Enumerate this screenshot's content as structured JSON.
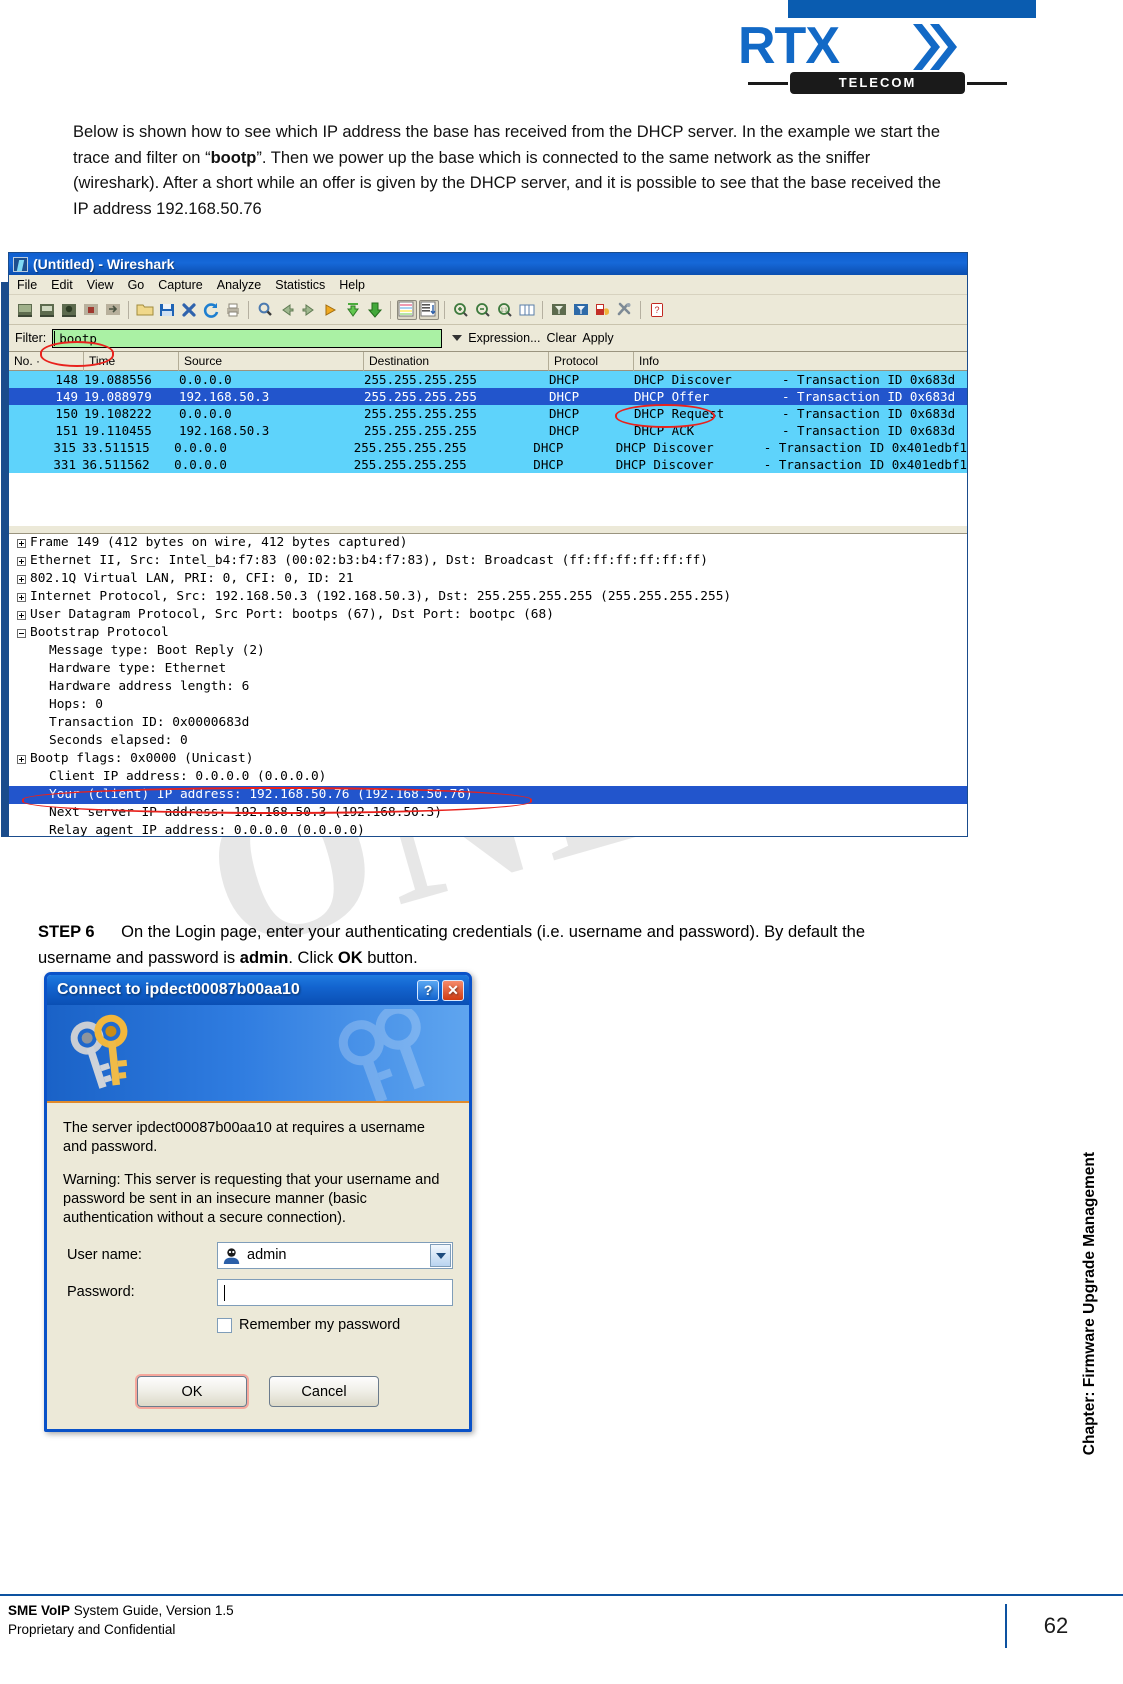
{
  "brand": {
    "name": "RTX",
    "sub": "TELECOM"
  },
  "intro_paragraph": "Below is shown how to see which IP address the base has received from the DHCP server. In the example we start the trace and filter on “bootp”. Then we power up the base which is connected to the same network as the sniffer (wireshark). After a short while an offer is given by the DHCP server, and it is possible to see that the base received the IP address 192.168.50.76",
  "intro_parts": {
    "p1": "Below is shown how to see which IP address the base has received from the DHCP server. In the example we start the trace and filter on “",
    "bold1": "bootp",
    "p2": "”. Then we power up the base which is connected to the same network as the sniffer (wireshark). After a short while an offer is given by the DHCP server, and it is possible to see that the base received the IP address 192.168.50.76"
  },
  "watermark": "ONLY",
  "step": {
    "label": "STEP 6",
    "text1": "On the Login page, enter your authenticating credentials (i.e. username and password). By default the username and password is ",
    "bold_admin": "admin",
    "text2": ". Click ",
    "bold_ok": "OK",
    "text3": " button."
  },
  "wireshark": {
    "title": "(Untitled) - Wireshark",
    "menu": [
      "File",
      "Edit",
      "View",
      "Go",
      "Capture",
      "Analyze",
      "Statistics",
      "Help"
    ],
    "filter": {
      "label": "Filter:",
      "value": "bootp",
      "placeholder": "",
      "expression_button": "Expression...",
      "clear_button": "Clear",
      "apply_button": "Apply"
    },
    "columns": [
      "No. ·",
      "Time",
      "Source",
      "Destination",
      "Protocol",
      "Info"
    ],
    "packets": [
      {
        "no": "148",
        "time": "19.088556",
        "src": "0.0.0.0",
        "dst": "255.255.255.255",
        "proto": "DHCP",
        "info_name": "DHCP Discover",
        "info_rest": "- Transaction ID 0x683d",
        "selected": false
      },
      {
        "no": "149",
        "time": "19.088979",
        "src": "192.168.50.3",
        "dst": "255.255.255.255",
        "proto": "DHCP",
        "info_name": "DHCP Offer",
        "info_rest": "- Transaction ID 0x683d",
        "selected": true
      },
      {
        "no": "150",
        "time": "19.108222",
        "src": "0.0.0.0",
        "dst": "255.255.255.255",
        "proto": "DHCP",
        "info_name": "DHCP Request",
        "info_rest": "- Transaction ID 0x683d",
        "selected": false
      },
      {
        "no": "151",
        "time": "19.110455",
        "src": "192.168.50.3",
        "dst": "255.255.255.255",
        "proto": "DHCP",
        "info_name": "DHCP ACK",
        "info_rest": "- Transaction ID 0x683d",
        "selected": false
      },
      {
        "no": "315",
        "time": "33.511515",
        "src": "0.0.0.0",
        "dst": "255.255.255.255",
        "proto": "DHCP",
        "info_name": "DHCP Discover",
        "info_rest": "- Transaction ID 0x401edbf1",
        "selected": false
      },
      {
        "no": "331",
        "time": "36.511562",
        "src": "0.0.0.0",
        "dst": "255.255.255.255",
        "proto": "DHCP",
        "info_name": "DHCP Discover",
        "info_rest": "- Transaction ID 0x401edbf1",
        "selected": false
      }
    ],
    "details": [
      {
        "text": "Frame 149 (412 bytes on wire, 412 bytes captured)",
        "expander": "plus",
        "indent": 0,
        "selected": false
      },
      {
        "text": "Ethernet II, Src: Intel_b4:f7:83 (00:02:b3:b4:f7:83), Dst: Broadcast (ff:ff:ff:ff:ff:ff)",
        "expander": "plus",
        "indent": 0,
        "selected": false
      },
      {
        "text": "802.1Q Virtual LAN, PRI: 0, CFI: 0, ID: 21",
        "expander": "plus",
        "indent": 0,
        "selected": false
      },
      {
        "text": "Internet Protocol, Src: 192.168.50.3 (192.168.50.3), Dst: 255.255.255.255 (255.255.255.255)",
        "expander": "plus",
        "indent": 0,
        "selected": false
      },
      {
        "text": "User Datagram Protocol, Src Port: bootps (67), Dst Port: bootpc (68)",
        "expander": "plus",
        "indent": 0,
        "selected": false
      },
      {
        "text": "Bootstrap Protocol",
        "expander": "minus",
        "indent": 0,
        "selected": false
      },
      {
        "text": "Message type: Boot Reply (2)",
        "expander": "none",
        "indent": 1,
        "selected": false
      },
      {
        "text": "Hardware type: Ethernet",
        "expander": "none",
        "indent": 1,
        "selected": false
      },
      {
        "text": "Hardware address length: 6",
        "expander": "none",
        "indent": 1,
        "selected": false
      },
      {
        "text": "Hops: 0",
        "expander": "none",
        "indent": 1,
        "selected": false
      },
      {
        "text": "Transaction ID: 0x0000683d",
        "expander": "none",
        "indent": 1,
        "selected": false
      },
      {
        "text": "Seconds elapsed: 0",
        "expander": "none",
        "indent": 1,
        "selected": false
      },
      {
        "text": "Bootp flags: 0x0000 (Unicast)",
        "expander": "plus",
        "indent": 0,
        "selected": false
      },
      {
        "text": "Client IP address: 0.0.0.0 (0.0.0.0)",
        "expander": "none",
        "indent": 1,
        "selected": false
      },
      {
        "text": "Your (client) IP address: 192.168.50.76 (192.168.50.76)",
        "expander": "none",
        "indent": 1,
        "selected": true
      },
      {
        "text": "Next server IP address: 192.168.50.3 (192.168.50.3)",
        "expander": "none",
        "indent": 1,
        "selected": false
      },
      {
        "text": "Relay agent IP address: 0.0.0.0 (0.0.0.0)",
        "expander": "none",
        "indent": 1,
        "selected": false
      }
    ]
  },
  "auth_dialog": {
    "title": "Connect to ipdect00087b00aa10",
    "help_button": "?",
    "close_button": "✕",
    "message1": "The server ipdect00087b00aa10 at  requires a username and password.",
    "message2": "Warning: This server is requesting that your username and password be sent in an insecure manner (basic authentication without a secure connection).",
    "username_label": "User name:",
    "username_value": "admin",
    "password_label": "Password:",
    "password_value": "",
    "remember_label": "Remember my password",
    "ok_button": "OK",
    "cancel_button": "Cancel"
  },
  "chapter_sidebar": "Chapter: Firmware Upgrade Management",
  "footer": {
    "line1_bold_a": "SME VoIP",
    "line1_rest": " System Guide, Version 1.5",
    "line2": "Proprietary and Confidential",
    "page": "62"
  },
  "colors": {
    "brand_blue": "#1269c6",
    "highlight_red": "#e8221d",
    "packet_cyan": "#5ed3fb",
    "packet_selected": "#2255cc",
    "filter_green": "#aaf1a4"
  }
}
